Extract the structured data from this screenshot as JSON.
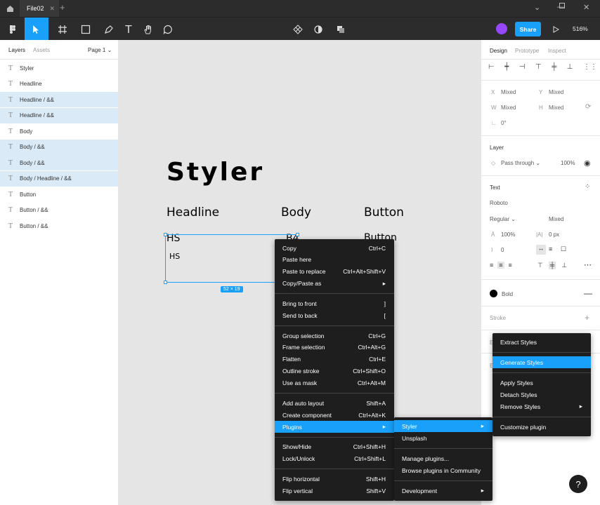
{
  "titlebar": {
    "file_tab": "File02"
  },
  "toolbar": {
    "share_label": "Share",
    "zoom": "516%"
  },
  "layers_panel": {
    "tabs": [
      "Layers",
      "Assets"
    ],
    "page": "Page 1",
    "layers": [
      {
        "name": "Styler",
        "selected": false
      },
      {
        "name": "Headline",
        "selected": false
      },
      {
        "name": "Headline / &&",
        "selected": true
      },
      {
        "name": "Headline / &&",
        "selected": true
      },
      {
        "name": "Body",
        "selected": false
      },
      {
        "name": "Body / &&",
        "selected": true
      },
      {
        "name": "Body / &&",
        "selected": true
      },
      {
        "name": "Body / Headline / &&",
        "selected": true
      },
      {
        "name": "Button",
        "selected": false
      },
      {
        "name": "Button / &&",
        "selected": false
      },
      {
        "name": "Button / &&",
        "selected": false
      }
    ]
  },
  "canvas": {
    "title": "Styler",
    "columns": [
      "Headline",
      "Body",
      "Button"
    ],
    "sample_hs_large": "HS",
    "sample_hs_small": "HS",
    "sample_b4": "B4",
    "sample_button": "Button",
    "dimensions": "52 × 19"
  },
  "design_panel": {
    "tabs": [
      "Design",
      "Prototype",
      "Inspect"
    ],
    "x_label": "X",
    "x_value": "Mixed",
    "y_label": "Y",
    "y_value": "Mixed",
    "w_label": "W",
    "w_value": "Mixed",
    "h_label": "H",
    "h_value": "Mixed",
    "rotation": "0°",
    "layer_title": "Layer",
    "blend_mode": "Pass through",
    "opacity": "100%",
    "text_title": "Text",
    "font_family": "Roboto",
    "font_weight": "Regular",
    "font_size": "Mixed",
    "line_height": "100%",
    "letter_spacing": "0 px",
    "paragraph_spacing": "0",
    "fill_name": "Bold",
    "stroke_title": "Stroke"
  },
  "context_menu": {
    "groups": [
      [
        {
          "label": "Copy",
          "shortcut": "Ctrl+C"
        },
        {
          "label": "Paste here",
          "shortcut": ""
        },
        {
          "label": "Paste to replace",
          "shortcut": "Ctrl+Alt+Shift+V"
        },
        {
          "label": "Copy/Paste as",
          "shortcut": "▸"
        }
      ],
      [
        {
          "label": "Bring to front",
          "shortcut": "]"
        },
        {
          "label": "Send to back",
          "shortcut": "["
        }
      ],
      [
        {
          "label": "Group selection",
          "shortcut": "Ctrl+G"
        },
        {
          "label": "Frame selection",
          "shortcut": "Ctrl+Alt+G"
        },
        {
          "label": "Flatten",
          "shortcut": "Ctrl+E"
        },
        {
          "label": "Outline stroke",
          "shortcut": "Ctrl+Shift+O"
        },
        {
          "label": "Use as mask",
          "shortcut": "Ctrl+Alt+M"
        }
      ],
      [
        {
          "label": "Add auto layout",
          "shortcut": "Shift+A"
        },
        {
          "label": "Create component",
          "shortcut": "Ctrl+Alt+K"
        },
        {
          "label": "Plugins",
          "shortcut": "▸",
          "highlighted": true
        }
      ],
      [
        {
          "label": "Show/Hide",
          "shortcut": "Ctrl+Shift+H"
        },
        {
          "label": "Lock/Unlock",
          "shortcut": "Ctrl+Shift+L"
        }
      ],
      [
        {
          "label": "Flip horizontal",
          "shortcut": "Shift+H"
        },
        {
          "label": "Flip vertical",
          "shortcut": "Shift+V"
        }
      ]
    ]
  },
  "plugins_menu": {
    "items": [
      {
        "label": "Styler",
        "shortcut": "▸",
        "highlighted": true
      },
      {
        "label": "Unsplash",
        "shortcut": ""
      },
      {
        "label": "Manage plugins...",
        "shortcut": ""
      },
      {
        "label": "Browse plugins in Community",
        "shortcut": ""
      },
      {
        "label": "Development",
        "shortcut": "▸"
      }
    ]
  },
  "styler_menu": {
    "items": [
      {
        "label": "Extract Styles",
        "shortcut": ""
      },
      {
        "label": "Generate Styles",
        "shortcut": "",
        "highlighted": true
      },
      {
        "label": "Apply Styles",
        "shortcut": ""
      },
      {
        "label": "Detach Styles",
        "shortcut": ""
      },
      {
        "label": "Remove Styles",
        "shortcut": "▸"
      },
      {
        "label": "Customize plugin",
        "shortcut": ""
      }
    ]
  },
  "help": "?"
}
